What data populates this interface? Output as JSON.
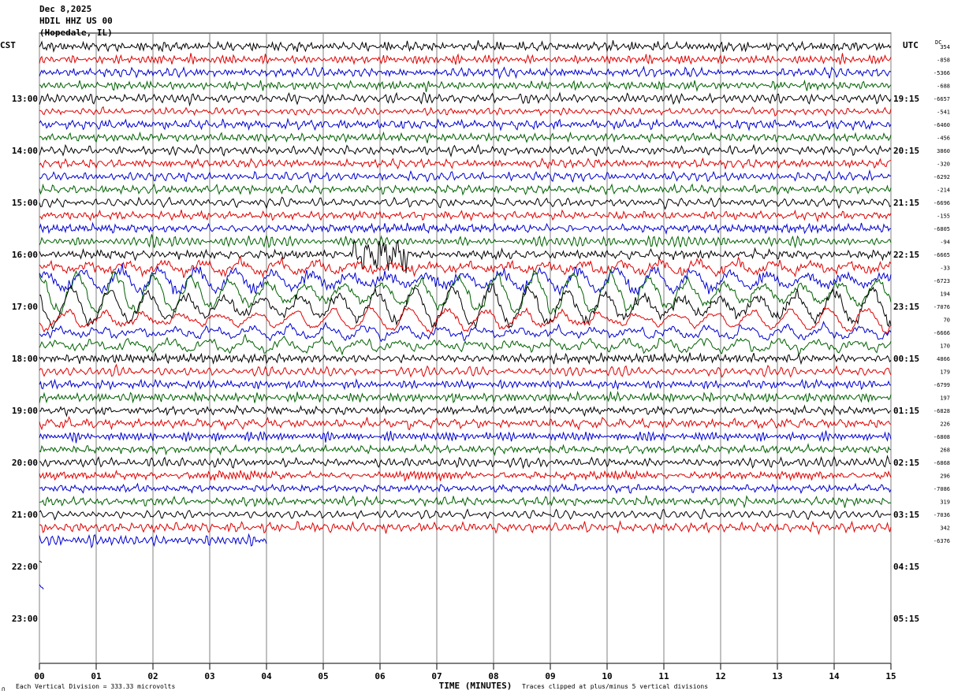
{
  "header": {
    "date": "Dec 8,2025",
    "station": "HDIL HHZ US 00",
    "location": "(Hopedale, IL)"
  },
  "labels": {
    "left_tz": "CST",
    "right_tz": "UTC",
    "dc": "DC",
    "xlabel": "TIME (MINUTES)"
  },
  "footer": {
    "scale": "Each Vertical Division =  333.33 microvolts",
    "clip": "Traces clipped at plus/minus 5 vertical divisions",
    "mark": "∩"
  },
  "colors": {
    "cycle": [
      "#000000",
      "#e00000",
      "#0000d0",
      "#006000"
    ],
    "grid": "#808080"
  },
  "chart_data": {
    "type": "line",
    "title": "",
    "xlabel": "TIME (MINUTES)",
    "ylabel": "",
    "x_ticks": [
      "00",
      "01",
      "02",
      "03",
      "04",
      "05",
      "06",
      "07",
      "08",
      "09",
      "10",
      "11",
      "12",
      "13",
      "14",
      "15"
    ],
    "xlim": [
      0,
      15
    ],
    "left_hour_labels": [
      "13:00",
      "14:00",
      "15:00",
      "16:00",
      "17:00",
      "18:00",
      "19:00",
      "20:00",
      "21:00",
      "22:00",
      "23:00"
    ],
    "right_hour_labels": [
      "19:15",
      "20:15",
      "21:15",
      "22:15",
      "23:15",
      "00:15",
      "01:15",
      "02:15",
      "03:15",
      "04:15",
      "05:15"
    ],
    "rows_per_hour": 4,
    "dc_offsets": [
      "354",
      "-858",
      "-5366",
      "-688",
      "-6657",
      "-541",
      "-6460",
      "-456",
      "3860",
      "-320",
      "-6292",
      "-214",
      "-6696",
      "-155",
      "-6805",
      "-94",
      "-6665",
      "-33",
      "-6723",
      "194",
      "-7076",
      "70",
      "-6666",
      "170",
      "4866",
      "179",
      "-6799",
      "197",
      "-6828",
      "226",
      "-6808",
      "268",
      "-6868",
      "296",
      "-7086",
      "319",
      "-7036",
      "342",
      "-6376"
    ],
    "events": [
      {
        "row": 16,
        "start_minute": 5.5,
        "end_minute": 6.5,
        "description": "impulsive burst"
      },
      {
        "row_start": 17,
        "row_end": 23,
        "description": "large long-period surface waves"
      }
    ],
    "last_trace_end_minute": 4.0,
    "grid": true
  }
}
